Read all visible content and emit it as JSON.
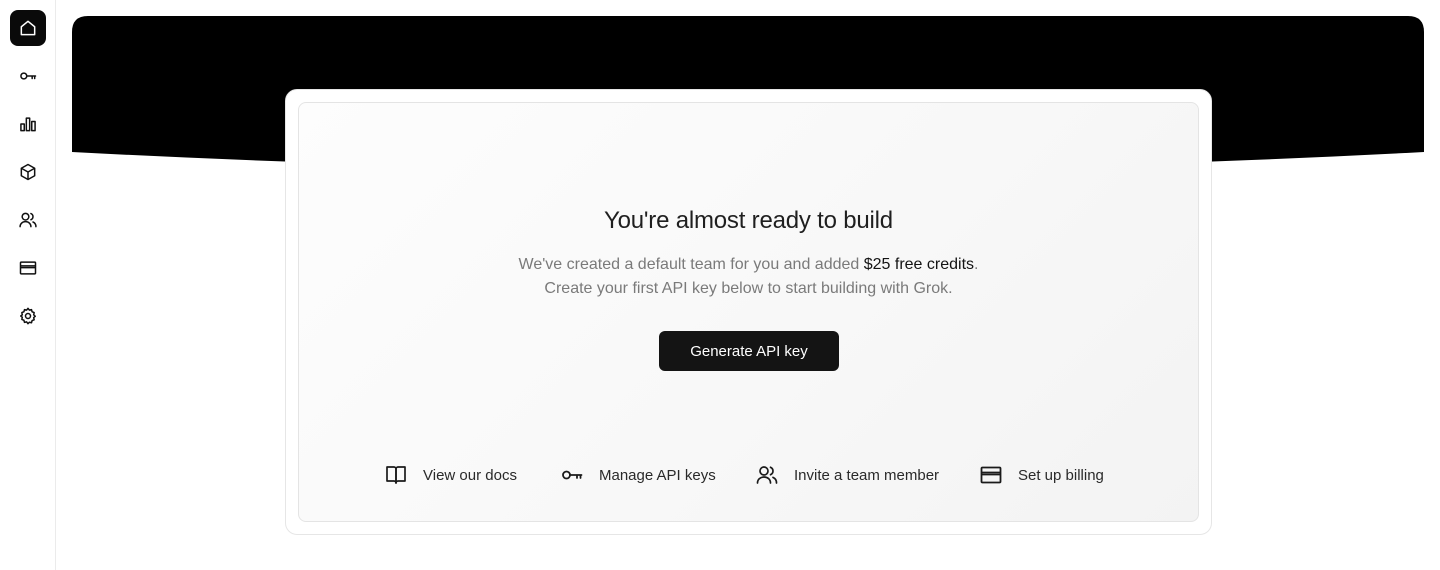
{
  "sidebar": {
    "items": [
      {
        "id": "home",
        "icon": "home-icon",
        "active": true
      },
      {
        "id": "api-keys",
        "icon": "key-icon",
        "active": false
      },
      {
        "id": "usage",
        "icon": "bar-chart-icon",
        "active": false
      },
      {
        "id": "models",
        "icon": "cube-icon",
        "active": false
      },
      {
        "id": "team",
        "icon": "users-icon",
        "active": false
      },
      {
        "id": "billing",
        "icon": "credit-card-icon",
        "active": false
      },
      {
        "id": "settings",
        "icon": "gear-icon",
        "active": false
      }
    ]
  },
  "card": {
    "title": "You're almost ready to build",
    "subtitle_prefix": "We've created a default team for you and added ",
    "subtitle_highlight": "$25 free credits",
    "subtitle_suffix": ".",
    "subtitle_line2": "Create your first API key below to start building with Grok.",
    "primary_button": "Generate API key",
    "links": {
      "docs": {
        "label": "View our docs",
        "icon": "book-icon"
      },
      "keys": {
        "label": "Manage API keys",
        "icon": "key-icon"
      },
      "invite": {
        "label": "Invite a team member",
        "icon": "users-icon"
      },
      "billing": {
        "label": "Set up billing",
        "icon": "credit-card-icon"
      }
    }
  },
  "colors": {
    "accent": "#0a0a0a",
    "banner": "#000000",
    "muted_text": "#7a7a7a",
    "button_bg": "#141414"
  }
}
